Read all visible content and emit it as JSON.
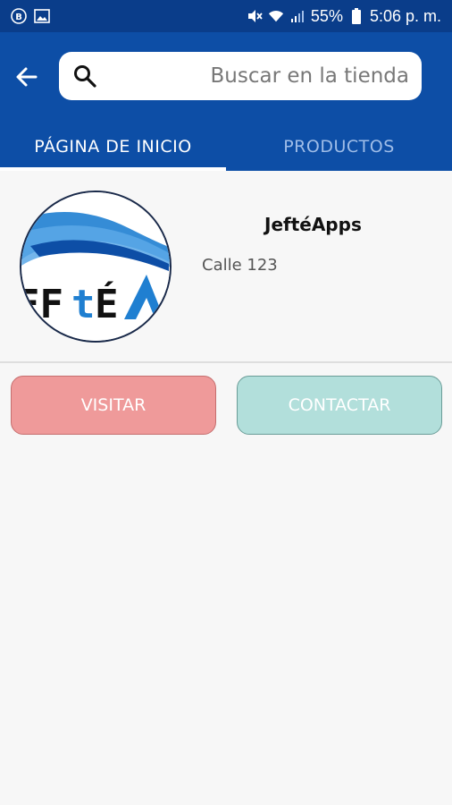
{
  "status_bar": {
    "battery": "55%",
    "time": "5:06 p. m.",
    "icons": [
      "b-icon",
      "image-icon",
      "mute-icon",
      "wifi-icon",
      "signal-icon",
      "battery-icon"
    ]
  },
  "app_bar": {
    "back_icon": "arrow-left-icon",
    "search": {
      "placeholder": "Buscar en la tienda",
      "value": ""
    },
    "tabs": [
      {
        "label": "PÁGINA DE INICIO",
        "active": true
      },
      {
        "label": "PRODUCTOS",
        "active": false
      }
    ]
  },
  "store": {
    "name": "JeftéApps",
    "address": "Calle 123",
    "logo_text": "JEFtÉA"
  },
  "actions": {
    "visit_label": "VISITAR",
    "contact_label": "CONTACTAR"
  },
  "colors": {
    "status_bar": "#0a3d8a",
    "app_bar": "#0d4ea6",
    "visit_button": "#ef9a9a",
    "contact_button": "#b2dfdb"
  }
}
